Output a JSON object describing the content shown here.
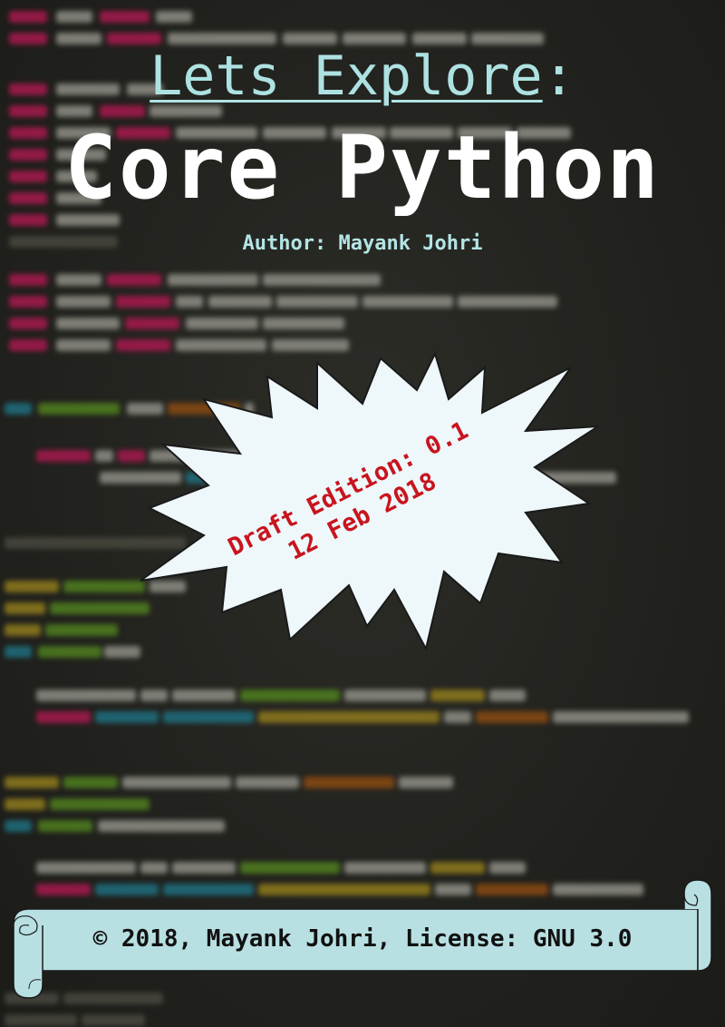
{
  "cover": {
    "title_prefix": "Lets Explore",
    "title_colon": ":",
    "title_main": "Core Python",
    "author": "Author: Mayank Johri",
    "stamp": {
      "line1": "Draft Edition: 0.1",
      "line2": "12 Feb 2018"
    },
    "footer": "© 2018, Mayank Johri, License: GNU 3.0"
  },
  "colors": {
    "title_accent": "#aee2e2",
    "title_main": "#ffffff",
    "stamp_fill": "#eef7fa",
    "stamp_text": "#c8141e",
    "banner_fill": "#b8e0e2",
    "background": "#23231f"
  }
}
